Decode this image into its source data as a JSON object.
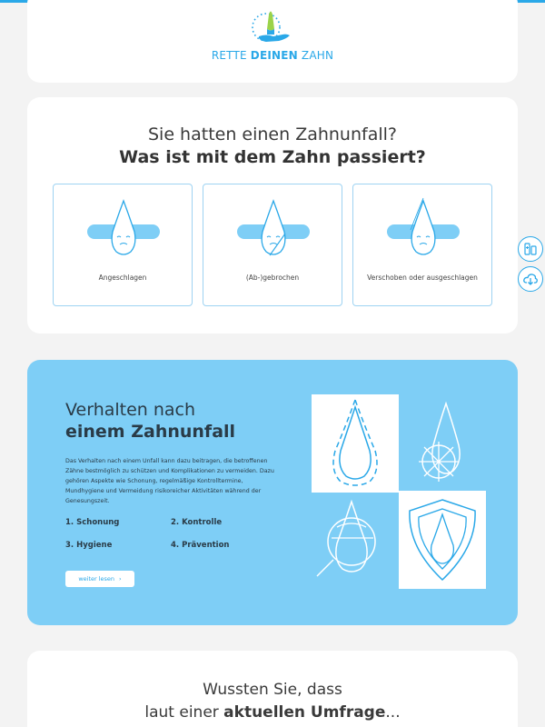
{
  "brand": {
    "name_part1": "RETTE ",
    "name_part2": "DEINEN",
    "name_part3": " ZAHN",
    "accent_color": "#2aa8e8",
    "logo_icon": "tooth-in-hand-logo"
  },
  "accident": {
    "question_line1": "Sie hatten einen Zahnunfall?",
    "question_line2": "Was ist mit dem Zahn passiert?",
    "options": [
      {
        "label": "Angeschlagen",
        "icon": "chipped-tooth-icon"
      },
      {
        "label": "(Ab-)gebrochen",
        "icon": "broken-tooth-icon"
      },
      {
        "label": "Verschoben oder ausgeschlagen",
        "icon": "displaced-tooth-icon"
      }
    ]
  },
  "side_widgets": [
    {
      "icon": "dental-kit-icon"
    },
    {
      "icon": "download-cloud-icon"
    }
  ],
  "behavior": {
    "title_line1": "Verhalten nach",
    "title_line2": "einem Zahnunfall",
    "text": "Das Verhalten nach einem Unfall kann dazu beitragen, die betroffenen Zähne bestmöglich zu schützen und Komplikationen zu vermeiden. Dazu gehören Aspekte wie Schonung, regelmäßige Kontrolltermine, Mundhygiene und Vermeidung risikoreicher Aktivitäten während der Genesungszeit.",
    "items": [
      "1. Schonung",
      "2. Kontrolle",
      "3. Hygiene",
      "4. Prävention"
    ],
    "read_more_label": "weiter lesen",
    "read_more_arrow": "›",
    "background_color": "#7ecef6"
  },
  "survey": {
    "line1": "Wussten Sie, dass",
    "line2_plain": "laut einer ",
    "line2_bold": "aktuellen Umfrage",
    "line2_end": "..."
  }
}
